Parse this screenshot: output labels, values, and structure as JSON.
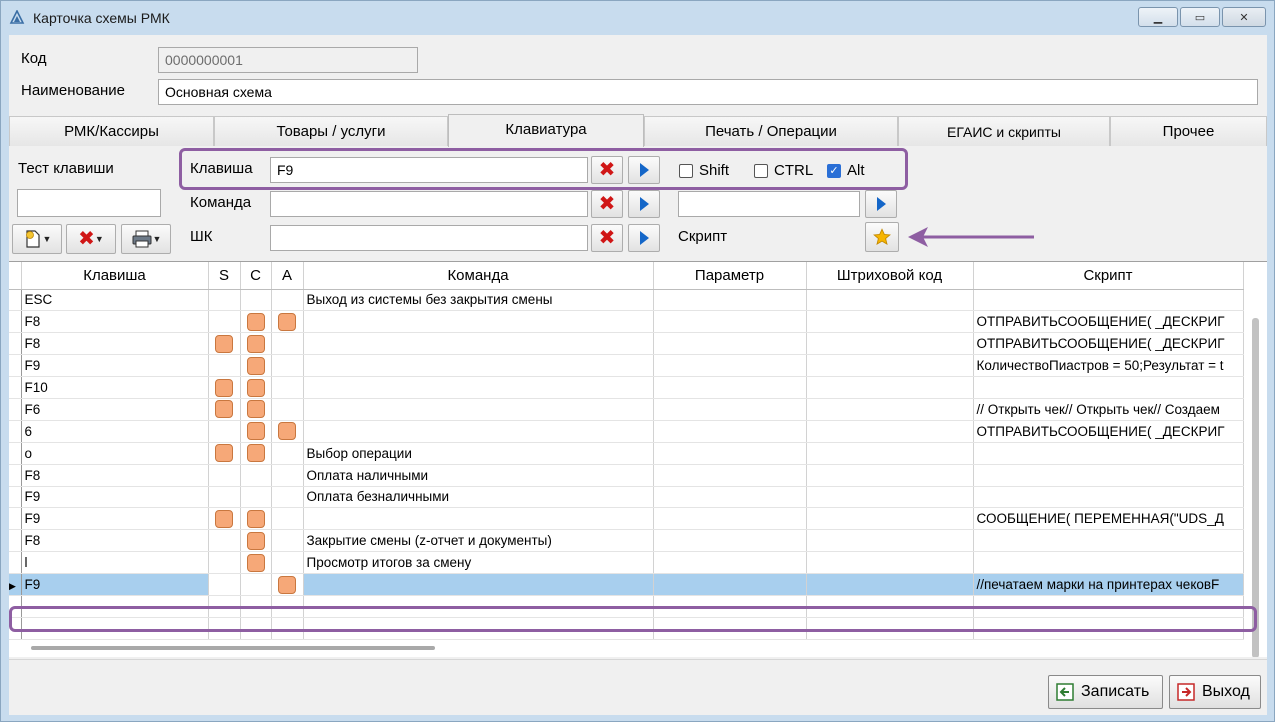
{
  "window": {
    "title": "Карточка схемы РМК"
  },
  "header": {
    "code_label": "Код",
    "code_value": "0000000001",
    "name_label": "Наименование",
    "name_value": "Основная схема"
  },
  "tabs": [
    {
      "label": "РМК/Кассиры",
      "active": false
    },
    {
      "label": "Товары / услуги",
      "active": false
    },
    {
      "label": "Клавиатура",
      "active": true
    },
    {
      "label": "Печать / Операции",
      "active": false
    },
    {
      "label": "ЕГАИС и скрипты",
      "active": false
    },
    {
      "label": "Прочее",
      "active": false
    }
  ],
  "keyboard": {
    "test_key_label": "Тест клавиши",
    "test_key_value": "",
    "key_label": "Клавиша",
    "key_value": "F9",
    "command_label": "Команда",
    "command_value": "",
    "barcode_label": "ШК",
    "barcode_value": "",
    "script_label": "Скрипт",
    "param_value": "",
    "shift_label": "Shift",
    "shift_checked": false,
    "ctrl_label": "CTRL",
    "ctrl_checked": false,
    "alt_label": "Alt",
    "alt_checked": true
  },
  "grid": {
    "columns": [
      "Клавиша",
      "S",
      "C",
      "A",
      "Команда",
      "Параметр",
      "Штриховой код",
      "Скрипт"
    ],
    "rows": [
      {
        "key": "ESC",
        "s": false,
        "c": false,
        "a": false,
        "command": "Выход из системы без закрытия смены",
        "param": "",
        "barcode": "",
        "script": ""
      },
      {
        "key": "F8",
        "s": false,
        "c": true,
        "a": true,
        "command": "",
        "param": "",
        "barcode": "",
        "script": "ОТПРАВИТЬСООБЩЕНИЕ( _ДЕСКРИГ"
      },
      {
        "key": "F8",
        "s": true,
        "c": true,
        "a": false,
        "command": "",
        "param": "",
        "barcode": "",
        "script": "ОТПРАВИТЬСООБЩЕНИЕ( _ДЕСКРИГ"
      },
      {
        "key": "F9",
        "s": false,
        "c": true,
        "a": false,
        "command": "",
        "param": "",
        "barcode": "",
        "script": "КоличествоПиастров = 50;Результат = t"
      },
      {
        "key": "F10",
        "s": true,
        "c": true,
        "a": false,
        "command": "",
        "param": "",
        "barcode": "",
        "script": ""
      },
      {
        "key": "F6",
        "s": true,
        "c": true,
        "a": false,
        "command": "",
        "param": "",
        "barcode": "",
        "script": "// Открыть чек// Открыть чек// Создаем"
      },
      {
        "key": "6",
        "s": false,
        "c": true,
        "a": true,
        "command": "",
        "param": "",
        "barcode": "",
        "script": "ОТПРАВИТЬСООБЩЕНИЕ( _ДЕСКРИГ"
      },
      {
        "key": "o",
        "s": true,
        "c": true,
        "a": false,
        "command": "Выбор операции",
        "param": "",
        "barcode": "",
        "script": ""
      },
      {
        "key": "F8",
        "s": false,
        "c": false,
        "a": false,
        "command": "Оплата наличными",
        "param": "",
        "barcode": "",
        "script": ""
      },
      {
        "key": "F9",
        "s": false,
        "c": false,
        "a": false,
        "command": "Оплата безналичными",
        "param": "",
        "barcode": "",
        "script": ""
      },
      {
        "key": "F9",
        "s": true,
        "c": true,
        "a": false,
        "command": "",
        "param": "",
        "barcode": "",
        "script": "СООБЩЕНИЕ( ПЕРЕМЕННАЯ(\"UDS_Д"
      },
      {
        "key": "F8",
        "s": false,
        "c": true,
        "a": false,
        "command": "Закрытие смены (z-отчет и документы)",
        "param": "",
        "barcode": "",
        "script": ""
      },
      {
        "key": "l",
        "s": false,
        "c": true,
        "a": false,
        "command": "Просмотр итогов за смену",
        "param": "",
        "barcode": "",
        "script": ""
      },
      {
        "key": "F9",
        "s": false,
        "c": false,
        "a": true,
        "command": "",
        "param": "",
        "barcode": "",
        "script": "//печатаем марки на принтерах чековF",
        "selected": true
      },
      {
        "key": "",
        "s": false,
        "c": false,
        "a": false,
        "command": "",
        "param": "",
        "barcode": "",
        "script": ""
      },
      {
        "key": "",
        "s": false,
        "c": false,
        "a": false,
        "command": "",
        "param": "",
        "barcode": "",
        "script": ""
      }
    ]
  },
  "footer": {
    "save_label": "Записать",
    "exit_label": "Выход"
  },
  "colors": {
    "titlebar": "#c8dcee",
    "highlight": "#8e5ea2",
    "selected_row": "#a8cfee",
    "flag": "#f6a878"
  }
}
